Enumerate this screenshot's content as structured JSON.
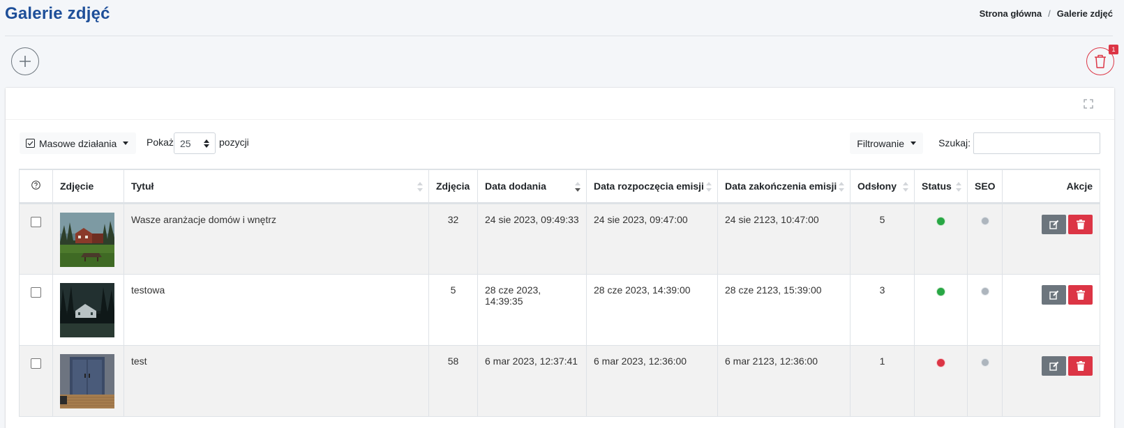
{
  "header": {
    "title": "Galerie zdjęć",
    "breadcrumb": {
      "home": "Strona główna",
      "separator": "/",
      "current": "Galerie zdjęć"
    }
  },
  "trash": {
    "badge": "1"
  },
  "toolbar": {
    "mass_actions": "Masowe działania",
    "show_label": "Pokaż",
    "page_size": "25",
    "items_label": "pozycji",
    "filter": "Filtrowanie",
    "search_label": "Szukaj:",
    "search_value": ""
  },
  "table": {
    "columns": {
      "photo": "Zdjęcie",
      "title": "Tytuł",
      "photos": "Zdjęcia",
      "date_added": "Data dodania",
      "start": "Data rozpoczęcia emisji",
      "end": "Data zakończenia emisji",
      "views": "Odsłony",
      "status": "Status",
      "seo": "SEO",
      "actions": "Akcje"
    },
    "rows": [
      {
        "title": "Wasze aranżacje domów i wnętrz",
        "photos": "32",
        "date_added": "24 sie 2023, 09:49:33",
        "start": "24 sie 2023, 09:47:00",
        "end": "24 sie 2123, 10:47:00",
        "views": "5",
        "status": "active",
        "seo": "none"
      },
      {
        "title": "testowa",
        "photos": "5",
        "date_added": "28 cze 2023, 14:39:35",
        "start": "28 cze 2023, 14:39:00",
        "end": "28 cze 2123, 15:39:00",
        "views": "3",
        "status": "active",
        "seo": "none"
      },
      {
        "title": "test",
        "photos": "58",
        "date_added": "6 mar 2023, 12:37:41",
        "start": "6 mar 2023, 12:36:00",
        "end": "6 mar 2123, 12:36:00",
        "views": "1",
        "status": "inactive",
        "seo": "none"
      }
    ]
  },
  "colors": {
    "accent": "#1e4f99",
    "danger": "#dc3545",
    "success": "#28a745",
    "secondary": "#6c757d"
  }
}
